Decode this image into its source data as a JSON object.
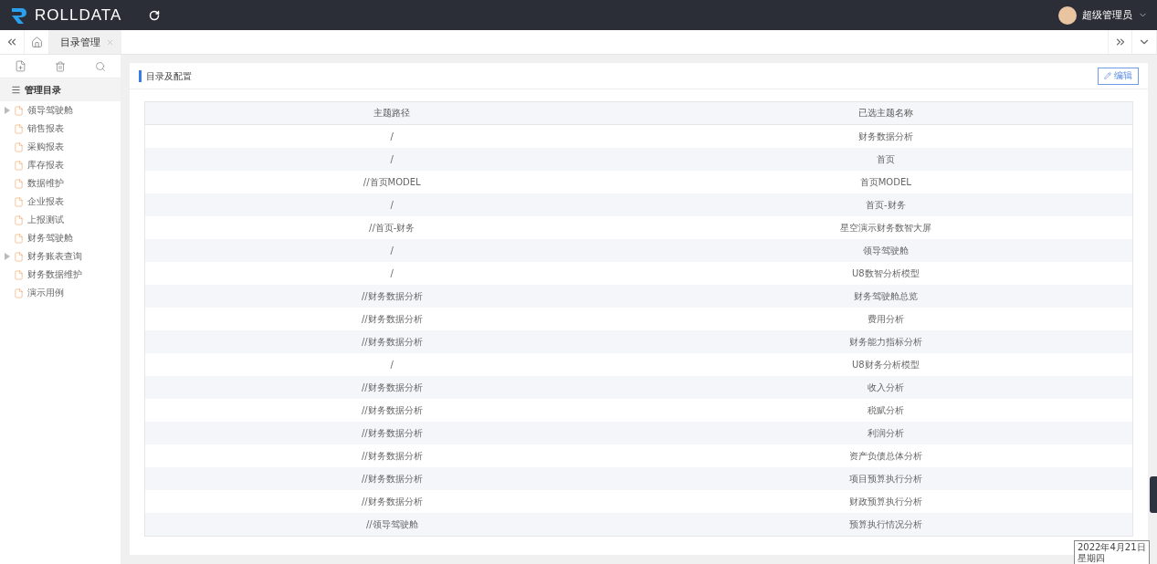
{
  "header": {
    "logo": "ROLLDATA",
    "user": "超级管理员"
  },
  "tabs": [
    {
      "label": "目录管理",
      "selected": true
    }
  ],
  "sidebar": {
    "title": "管理目录",
    "items": [
      {
        "label": "领导驾驶舱",
        "expandable": true
      },
      {
        "label": "销售报表",
        "expandable": false
      },
      {
        "label": "采购报表",
        "expandable": false
      },
      {
        "label": "库存报表",
        "expandable": false
      },
      {
        "label": "数据维护",
        "expandable": false
      },
      {
        "label": "企业报表",
        "expandable": false
      },
      {
        "label": "上报测试",
        "expandable": false
      },
      {
        "label": "财务驾驶舱",
        "expandable": false
      },
      {
        "label": "财务账表查询",
        "expandable": true
      },
      {
        "label": "财务数据维护",
        "expandable": false
      },
      {
        "label": "演示用例",
        "expandable": false
      }
    ]
  },
  "panel": {
    "title": "目录及配置",
    "edit_button": "编辑"
  },
  "table": {
    "columns": [
      "主题路径",
      "已选主题名称"
    ],
    "rows": [
      [
        "/",
        "财务数据分析"
      ],
      [
        "/",
        "首页"
      ],
      [
        "//首页MODEL",
        "首页MODEL"
      ],
      [
        "/",
        "首页-财务"
      ],
      [
        "//首页-财务",
        "星空演示财务数智大屏"
      ],
      [
        "/",
        "领导驾驶舱"
      ],
      [
        "/",
        "U8数智分析模型"
      ],
      [
        "//财务数据分析",
        "财务驾驶舱总览"
      ],
      [
        "//财务数据分析",
        "费用分析"
      ],
      [
        "//财务数据分析",
        "财务能力指标分析"
      ],
      [
        "/",
        "U8财务分析模型"
      ],
      [
        "//财务数据分析",
        "收入分析"
      ],
      [
        "//财务数据分析",
        "税赋分析"
      ],
      [
        "//财务数据分析",
        "利润分析"
      ],
      [
        "//财务数据分析",
        "资产负债总体分析"
      ],
      [
        "//财务数据分析",
        "项目预算执行分析"
      ],
      [
        "//财务数据分析",
        "财政预算执行分析"
      ],
      [
        "//领导驾驶舱",
        "预算执行情况分析"
      ]
    ]
  },
  "date_tooltip": {
    "date": "2022年4月21日",
    "weekday": "星期四"
  }
}
